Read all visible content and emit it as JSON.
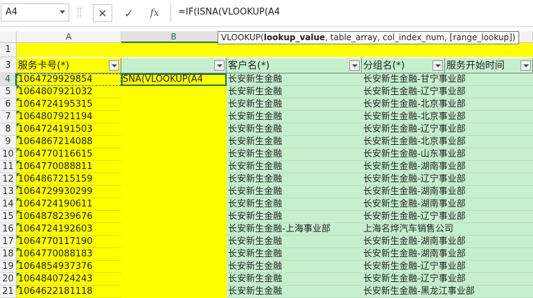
{
  "formula_bar": {
    "name_box": "A4",
    "formula": "=IF(ISNA(VLOOKUP(A4",
    "cancel_icon": "✕",
    "enter_icon": "✓",
    "fx_label": "fx"
  },
  "tooltip": {
    "fn": "VLOOKUP(",
    "arg_bold": "lookup_value",
    "rest": ", table_array, col_index_num, [range_lookup])"
  },
  "columns": [
    "A",
    "B"
  ],
  "row_numbers": [
    "1",
    "2",
    "3",
    "4",
    "5",
    "6",
    "7",
    "8",
    "9",
    "10",
    "11",
    "12",
    "13",
    "14",
    "15",
    "16",
    "17",
    "18",
    "19",
    "20",
    "21"
  ],
  "header_row": {
    "col_a": "服务卡号(*)",
    "col_b": "",
    "col_c": "客户名(*)",
    "col_d": "分组名(*)",
    "col_e": "服务开始时间"
  },
  "editing_cell_text": "SNA(VLOOKUP(A4",
  "rows": [
    {
      "a": "1064729929854",
      "c": "长安新生金融",
      "d": "长安新生金融-甘宁事业部"
    },
    {
      "a": "1064807921032",
      "c": "长安新生金融",
      "d": "长安新生金融-辽宁事业部"
    },
    {
      "a": "1064724195315",
      "c": "长安新生金融",
      "d": "长安新生金融-北京事业部"
    },
    {
      "a": "1064807921194",
      "c": "长安新生金融",
      "d": "长安新生金融-北京事业部"
    },
    {
      "a": "1064724191503",
      "c": "长安新生金融",
      "d": "长安新生金融-辽宁事业部"
    },
    {
      "a": "1064867214088",
      "c": "长安新生金融",
      "d": "长安新生金融-北京事业部"
    },
    {
      "a": "1064770116615",
      "c": "长安新生金融",
      "d": "长安新生金融-山东事业部"
    },
    {
      "a": "1064770088811",
      "c": "长安新生金融",
      "d": "长安新生金融-湖南事业部"
    },
    {
      "a": "1064867215159",
      "c": "长安新生金融",
      "d": "长安新生金融-辽宁事业部"
    },
    {
      "a": "1064729930299",
      "c": "长安新生金融",
      "d": "长安新生金融-湖南事业部"
    },
    {
      "a": "1064724190611",
      "c": "长安新生金融",
      "d": "长安新生金融-湖南事业部"
    },
    {
      "a": "1064878239676",
      "c": "长安新生金融",
      "d": "长安新生金融-辽宁事业部"
    },
    {
      "a": "1064724192603",
      "c": "长安新生金融-上海事业部",
      "d": "上海名烨汽车销售公司"
    },
    {
      "a": "1064770117190",
      "c": "长安新生金融",
      "d": "长安新生金融-湖南事业部"
    },
    {
      "a": "1064770088183",
      "c": "长安新生金融",
      "d": "长安新生金融-湖南事业部"
    },
    {
      "a": "1064854937376",
      "c": "长安新生金融",
      "d": "长安新生金融-辽宁事业部"
    },
    {
      "a": "1064840724243",
      "c": "长安新生金融",
      "d": "长安新生金融-辽宁事业部"
    },
    {
      "a": "1064622181118",
      "c": "长安新生金融",
      "d": "长安新生金融-黑龙江事业部"
    }
  ],
  "colors": {
    "yellow": "#ffff00",
    "green": "#c6efce",
    "select": "#217346"
  }
}
